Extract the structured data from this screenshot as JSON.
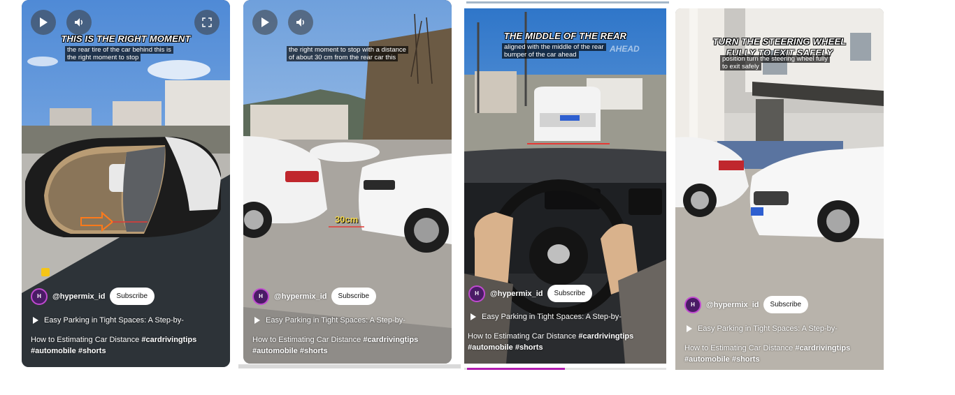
{
  "cards": [
    {
      "title": "THIS IS THE RIGHT MOMENT",
      "caption_line1": "the rear tire of the car behind this is",
      "caption_line2": "the right moment to stop",
      "channel": "@hypermix_id",
      "subscribe": "Subscribe",
      "playlist": "Easy Parking in Tight Spaces: A Step-by-",
      "desc_text": "How to Estimating Car Distance ",
      "desc_tags1": "#cardrivingtips",
      "desc_tags2": "#automobile #shorts"
    },
    {
      "caption_line1": "the right moment to stop with a distance",
      "caption_line2": "of about 30 cm from the rear car this",
      "measure": "30cm",
      "channel": "@hypermix_id",
      "subscribe": "Subscribe",
      "playlist": "Easy Parking in Tight Spaces: A Step-by-",
      "desc_text": "How to Estimating Car Distance ",
      "desc_tags1": "#cardrivingtips",
      "desc_tags2": "#automobile #shorts"
    },
    {
      "title": "THE MIDDLE OF THE REAR",
      "caption_line1": "aligned with the middle of the rear",
      "caption_line2": "bumper of the car ahead",
      "caption_bg_word": "AHEAD",
      "channel": "@hypermix_id",
      "subscribe": "Subscribe",
      "playlist": "Easy Parking in Tight Spaces: A Step-by-",
      "desc_text": "How to Estimating Car Distance ",
      "desc_tags1": "#cardrivingtips",
      "desc_tags2": "#automobile #shorts"
    },
    {
      "title": "TURN THE STEERING WHEEL",
      "title2": "FULLY TO EXIT SAFELY",
      "caption_line1": "position turn the steering wheel fully",
      "caption_line2": "to exit safely",
      "channel": "@hypermix_id",
      "subscribe": "Subscribe",
      "playlist": "Easy Parking in Tight Spaces: A Step-by-",
      "desc_text": "How to Estimating Car Distance ",
      "desc_tags1": "#cardrivingtips",
      "desc_tags2": "#automobile #shorts"
    }
  ],
  "avatar_text": "H",
  "colors": {
    "subscribe_bg": "#ffffff",
    "arrow": "#ff7a1a",
    "measure": "#f5d94a"
  }
}
